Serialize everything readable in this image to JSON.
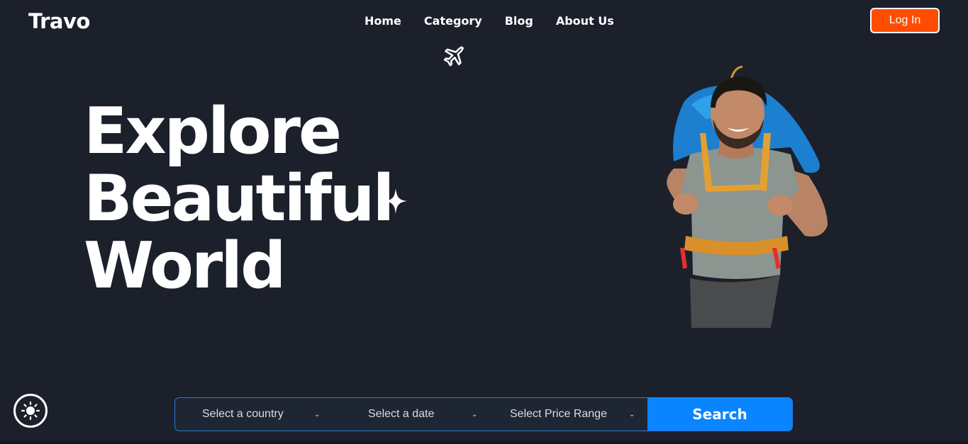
{
  "brand": {
    "name": "Travo"
  },
  "nav": {
    "items": [
      {
        "label": "Home"
      },
      {
        "label": "Category"
      },
      {
        "label": "Blog"
      },
      {
        "label": "About Us"
      }
    ]
  },
  "header": {
    "login_label": "Log In"
  },
  "hero": {
    "line1": "Explore",
    "line2": "Beautiful",
    "line3": "World"
  },
  "search": {
    "country_label": "Select a country",
    "date_label": "Select a date",
    "price_label": "Select Price Range",
    "button_label": "Search"
  },
  "icons": {
    "plane": "airplane-icon",
    "sparkle": "sparkle-icon",
    "theme": "sun-icon",
    "chevron": "chevron-down-icon"
  },
  "colors": {
    "background": "#1b202b",
    "accent_login": "#ff4d00",
    "accent_search": "#0a84ff",
    "searchbar_border": "#2c7ad6"
  }
}
